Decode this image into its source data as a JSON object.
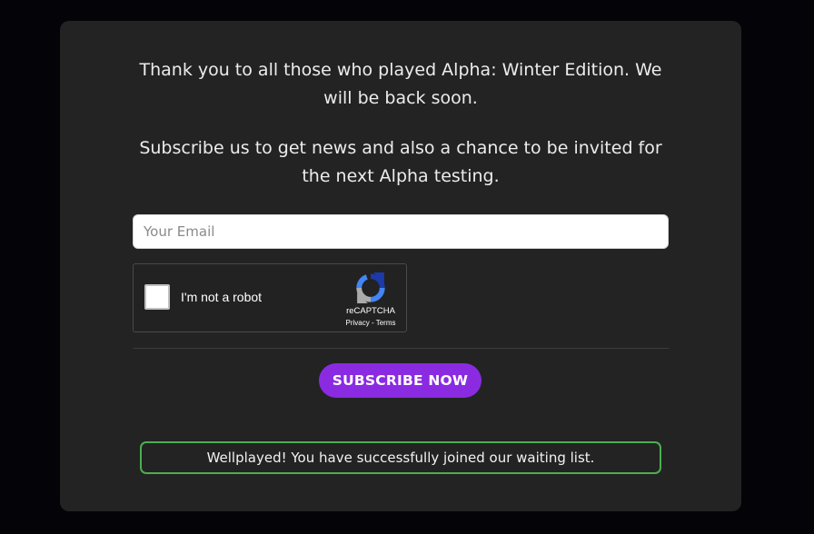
{
  "message": {
    "thanks": "Thank you to all those who played Alpha: Winter Edition. We will be back soon.",
    "subscribe_info": "Subscribe us to get news and also a chance to be invited for the next Alpha testing."
  },
  "form": {
    "email_placeholder": "Your Email",
    "email_value": ""
  },
  "recaptcha": {
    "label": "I'm not a robot",
    "brand": "reCAPTCHA",
    "privacy": "Privacy",
    "separator": " - ",
    "terms": "Terms",
    "icon": "recaptcha-logo"
  },
  "subscribe_button": {
    "label": "SUBSCRIBE NOW"
  },
  "status": {
    "success_message": "Wellplayed! You have successfully joined our waiting list."
  },
  "colors": {
    "page_background": "#040408",
    "card_background": "#232323",
    "accent": "#8a2be2",
    "success_border": "#4caf50"
  }
}
